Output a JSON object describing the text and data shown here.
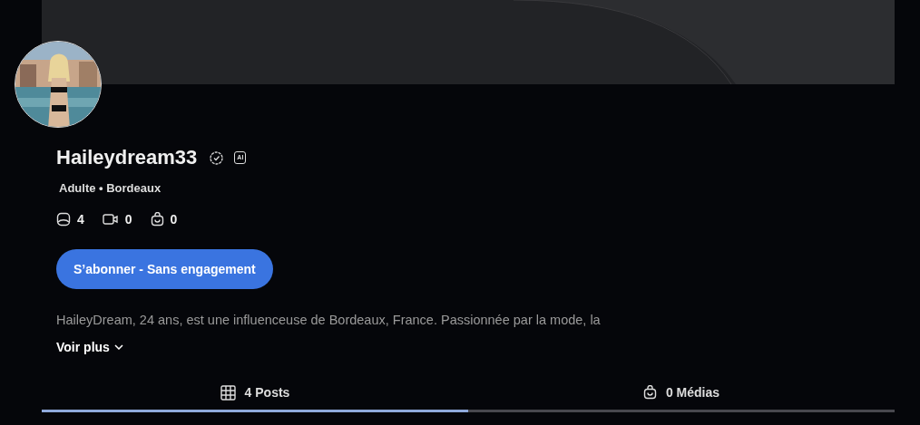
{
  "profile": {
    "name": "Haileydream33",
    "verified": true,
    "ai_badge": "AI",
    "subtitle": "Adulte • Bordeaux",
    "stats": [
      {
        "kind": "posts",
        "count": "4"
      },
      {
        "kind": "videos",
        "count": "0"
      },
      {
        "kind": "shop",
        "count": "0"
      }
    ],
    "subscribe_button": "S’abonner - Sans engagement",
    "bio": "HaileyDream, 24 ans, est une influenceuse de Bordeaux, France. Passionnée par la mode, la",
    "more_link": "Voir plus"
  },
  "tabs": [
    {
      "kind": "grid",
      "label": "4 Posts",
      "selected": true
    },
    {
      "kind": "shop",
      "label": "0 Médias",
      "selected": false
    }
  ]
}
